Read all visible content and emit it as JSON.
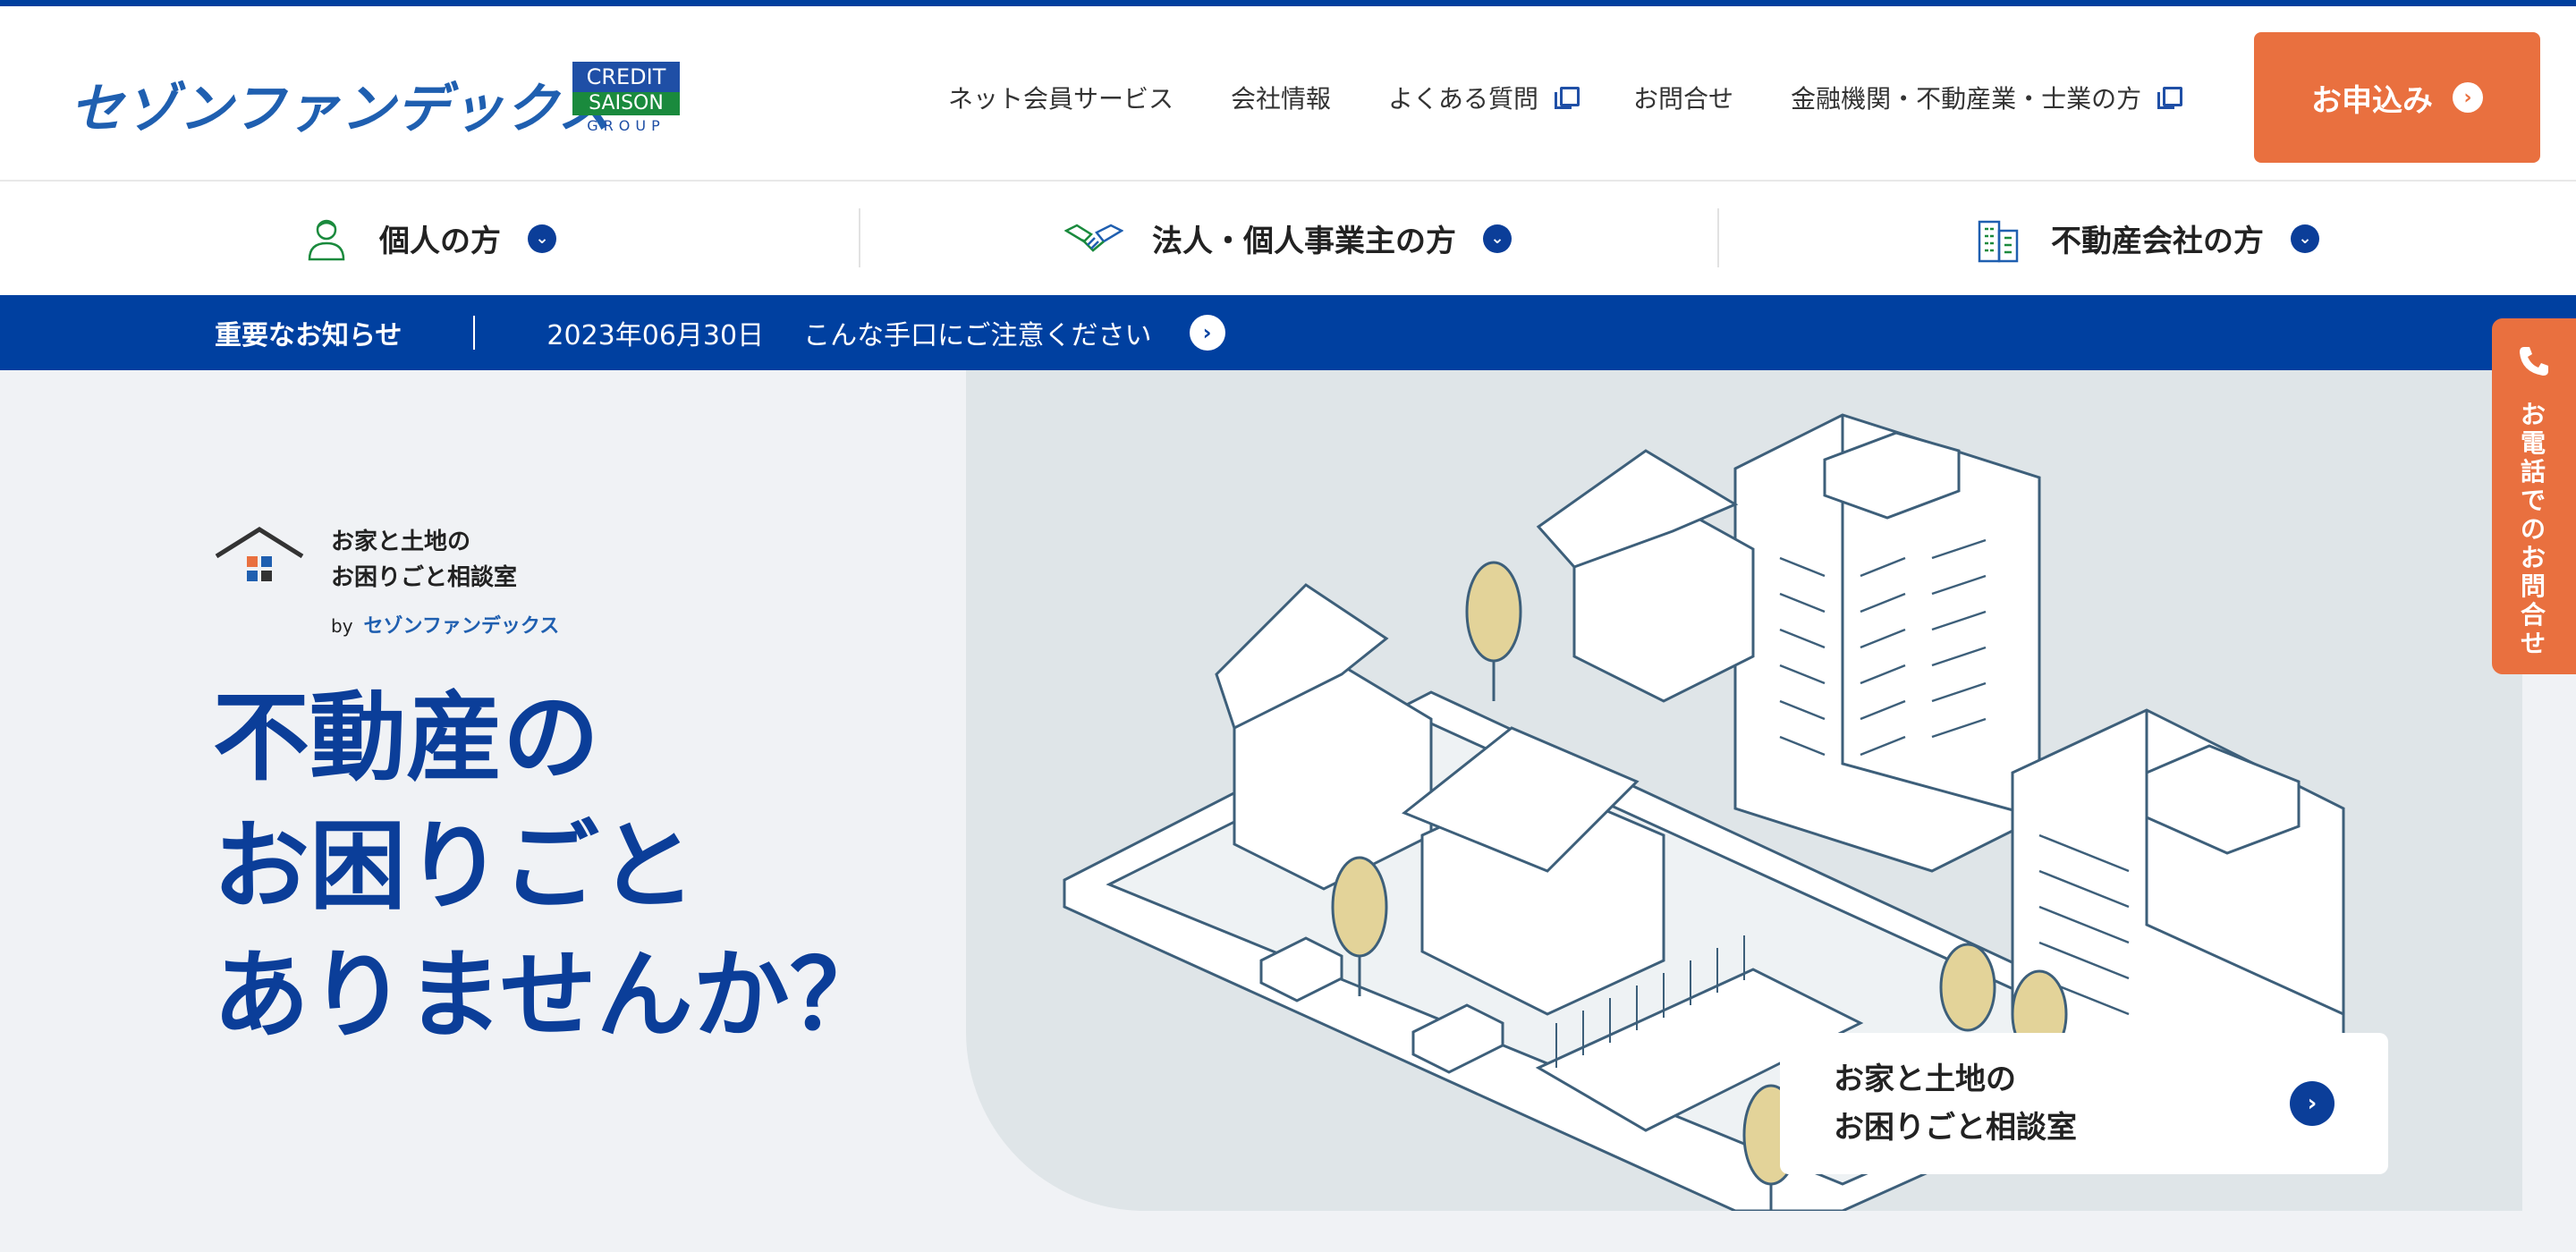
{
  "brand": {
    "logo_text": "セゾンファンデックス",
    "badge_line1": "CREDIT",
    "badge_line2": "SAISON",
    "badge_line3": "GROUP"
  },
  "nav": {
    "items": [
      {
        "label": "ネット会員サービス"
      },
      {
        "label": "会社情報"
      },
      {
        "label": "よくある質問"
      },
      {
        "label": "お問合せ"
      },
      {
        "label": "金融機関・不動産業・士業の方"
      }
    ],
    "apply_label": "お申込み"
  },
  "segments": [
    {
      "label": "個人の方",
      "icon": "person-icon"
    },
    {
      "label": "法人・個人事業主の方",
      "icon": "handshake-icon"
    },
    {
      "label": "不動産会社の方",
      "icon": "building-icon"
    }
  ],
  "notice": {
    "title": "重要なお知らせ",
    "date": "2023年06月30日",
    "text": "こんな手口にご注意ください"
  },
  "hero": {
    "brand_line1": "お家と土地の",
    "brand_line2": "お困りごと相談室",
    "brand_by": "by",
    "brand_by_name": "セゾンファンデックス",
    "title_line1": "不動産の",
    "title_line2": "お困りごと",
    "title_line3": "ありませんか？",
    "card_line1": "お家と土地の",
    "card_line2": "お困りごと相談室"
  },
  "side_tab": {
    "label": "お電話でのお問合せ"
  },
  "colors": {
    "primary_blue": "#0040a0",
    "accent_orange": "#e9703f",
    "hero_bg": "#f0f2f5"
  }
}
